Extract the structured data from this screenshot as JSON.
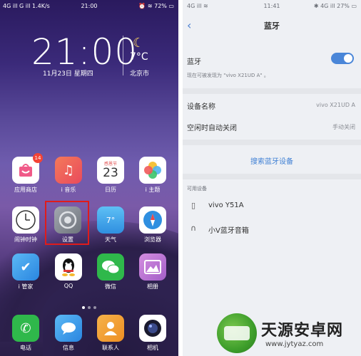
{
  "left": {
    "status_bar": {
      "left": "4G ill G ill 1.4K/s",
      "time": "21:00",
      "right": "⏰ ≋ 72% ▭"
    },
    "clock": {
      "time": "21:00",
      "date": "11月23日 星期四"
    },
    "weather": {
      "temp": "7°C",
      "city": "北京市",
      "icon": "moon-icon"
    },
    "apps_row1": [
      {
        "name": "app-store",
        "label": "应用商店",
        "badge": "14",
        "color": "#ffffff"
      },
      {
        "name": "i-music",
        "label": "i 音乐",
        "color": "#f06a55"
      },
      {
        "name": "calendar",
        "label": "日历",
        "day": "23",
        "top": "感恩节",
        "color": "#ffffff"
      },
      {
        "name": "i-theme",
        "label": "i 主题",
        "color": "#ffffff"
      }
    ],
    "apps_row2": [
      {
        "name": "alarm-clock",
        "label": "闹钟时钟",
        "color": "#ffffff"
      },
      {
        "name": "settings",
        "label": "设置",
        "color": "#8e949c"
      },
      {
        "name": "weather",
        "label": "天气",
        "temp": "7°",
        "color": "#4fb3f0"
      },
      {
        "name": "browser",
        "label": "浏览器",
        "color": "#2f8fe0"
      }
    ],
    "apps_row3": [
      {
        "name": "i-manager",
        "label": "i 管家",
        "color": "#3a9ae8"
      },
      {
        "name": "qq",
        "label": "QQ",
        "color": "#ffffff"
      },
      {
        "name": "wechat",
        "label": "微信",
        "color": "#2fb84b"
      },
      {
        "name": "album",
        "label": "相册",
        "color": "#c77ad6"
      }
    ],
    "dock": [
      {
        "name": "phone",
        "label": "电话",
        "color": "#2fb84b"
      },
      {
        "name": "messages",
        "label": "信息",
        "color": "#3a9ae8"
      },
      {
        "name": "contacts",
        "label": "联系人",
        "color": "#f0a03a"
      },
      {
        "name": "camera",
        "label": "相机",
        "color": "#ffffff"
      }
    ]
  },
  "right": {
    "status_bar": {
      "left": "4G ill ≋",
      "time": "11:41",
      "right": "✱ 4G ill 27% ▭"
    },
    "title": "蓝牙",
    "bluetooth_label": "蓝牙",
    "bluetooth_toggle": "on",
    "discoverable_text": "现在可被发现为 \"vivo X21UD A\" 。",
    "device_name_label": "设备名称",
    "device_name_value": "vivo X21UD A",
    "auto_off_label": "空闲时自动关闭",
    "auto_off_value": "手动关闭",
    "scan_button": "搜索蓝牙设备",
    "available_devices_label": "可用设备",
    "devices": [
      {
        "name": "vivo Y51A",
        "icon": "phone-icon"
      },
      {
        "name": "小V蓝牙音箱",
        "icon": "headphones-icon"
      }
    ]
  },
  "watermark": {
    "title": "天源安卓网",
    "url": "www.jytyaz.com"
  }
}
